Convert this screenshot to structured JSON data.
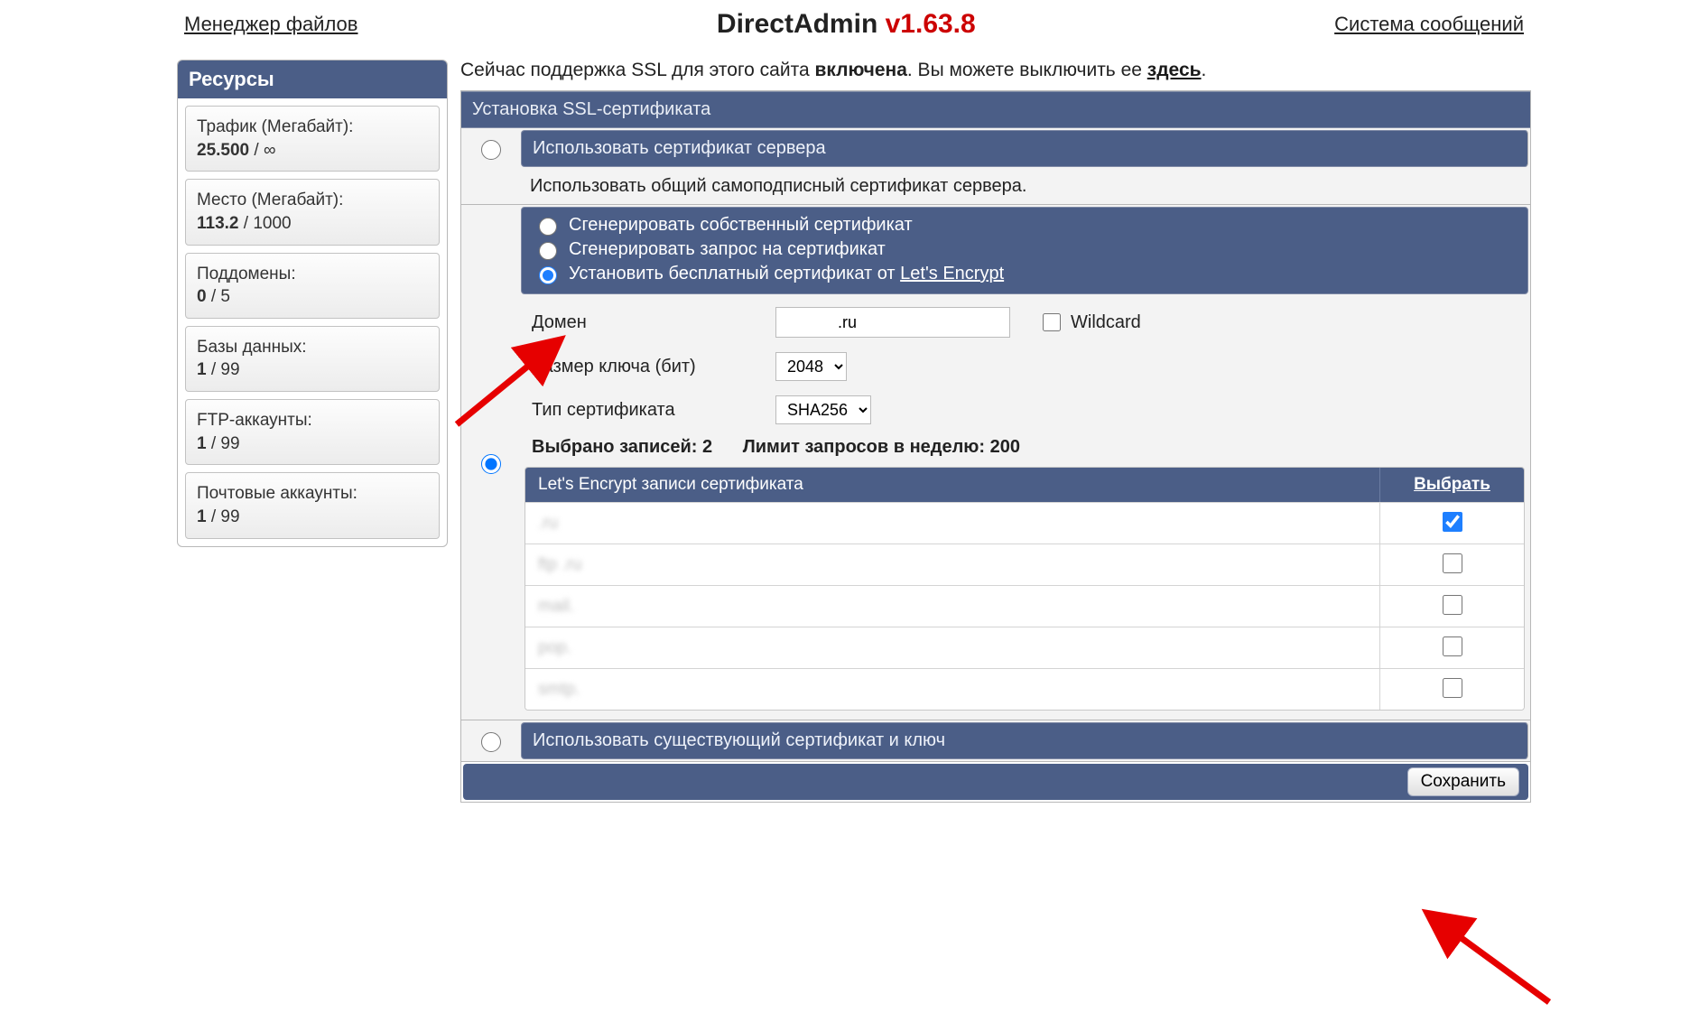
{
  "topbar": {
    "file_manager": "Менеджер файлов",
    "title_app": "DirectAdmin",
    "title_ver": "v1.63.8",
    "messages": "Система сообщений"
  },
  "sidebar": {
    "title": "Ресурсы",
    "stats": {
      "traffic_label": "Трафик (Мегабайт):",
      "traffic_used": "25.500",
      "traffic_sep": " / ",
      "traffic_limit": "∞",
      "disk_label": "Место (Мегабайт):",
      "disk_used": "113.2",
      "disk_sep": " / ",
      "disk_limit": "1000",
      "subdomains_label": "Поддомены:",
      "subdomains_used": "0",
      "subdomains_sep": " / ",
      "subdomains_limit": "5",
      "db_label": "Базы данных:",
      "db_used": "1",
      "db_sep": " / ",
      "db_limit": "99",
      "ftp_label": "FTP-аккаунты:",
      "ftp_used": "1",
      "ftp_sep": " / ",
      "ftp_limit": "99",
      "mail_label": "Почтовые аккаунты:",
      "mail_used": "1",
      "mail_sep": " / ",
      "mail_limit": "99"
    }
  },
  "intro": {
    "prefix": "Сейчас поддержка SSL для этого сайта ",
    "status": "включена",
    "middle": ". Вы можете выключить ее ",
    "link": "здесь",
    "suffix": "."
  },
  "panel": {
    "title": "Установка SSL-сертификата",
    "opt_server_cert": "Использовать сертификат сервера",
    "opt_server_desc": "Использовать общий самоподписный сертификат сервера.",
    "sub_self": "Сгенерировать собственный сертификат",
    "sub_csr": "Сгенерировать запрос на сертификат",
    "sub_le_prefix": "Установить бесплатный сертификат от ",
    "sub_le_link": "Let's Encrypt",
    "domain_label": "Домен",
    "domain_value": "            .ru",
    "wildcard_label": "Wildcard",
    "keysize_label": "Размер ключа (бит)",
    "keysize_value": "2048",
    "certtype_label": "Тип сертификата",
    "certtype_value": "SHA256",
    "selected_prefix": "Выбрано записей: ",
    "selected_count": "2",
    "limit_prefix": "Лимит запросов в неделю: ",
    "limit_count": "200",
    "records_title": "Let's Encrypt записи сертификата",
    "select_col": "Выбрать",
    "records": [
      {
        "name": "            .ru",
        "checked": true
      },
      {
        "name": "ftp          .ru",
        "checked": false
      },
      {
        "name": "mail.           ",
        "checked": false
      },
      {
        "name": "pop.            ",
        "checked": false
      },
      {
        "name": "smtp.           ",
        "checked": false
      }
    ],
    "opt_existing": "Использовать существующий сертификат и ключ",
    "save": "Сохранить"
  }
}
